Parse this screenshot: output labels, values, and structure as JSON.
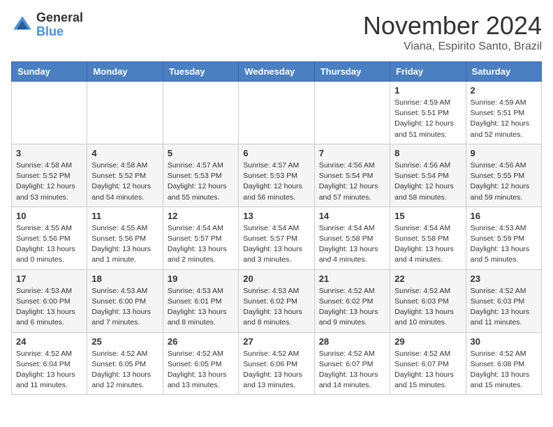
{
  "header": {
    "logo_general": "General",
    "logo_blue": "Blue",
    "month_title": "November 2024",
    "location": "Viana, Espirito Santo, Brazil"
  },
  "calendar": {
    "headers": [
      "Sunday",
      "Monday",
      "Tuesday",
      "Wednesday",
      "Thursday",
      "Friday",
      "Saturday"
    ],
    "rows": [
      [
        {
          "day": "",
          "info": ""
        },
        {
          "day": "",
          "info": ""
        },
        {
          "day": "",
          "info": ""
        },
        {
          "day": "",
          "info": ""
        },
        {
          "day": "",
          "info": ""
        },
        {
          "day": "1",
          "info": "Sunrise: 4:59 AM\nSunset: 5:51 PM\nDaylight: 12 hours\nand 51 minutes."
        },
        {
          "day": "2",
          "info": "Sunrise: 4:59 AM\nSunset: 5:51 PM\nDaylight: 12 hours\nand 52 minutes."
        }
      ],
      [
        {
          "day": "3",
          "info": "Sunrise: 4:58 AM\nSunset: 5:52 PM\nDaylight: 12 hours\nand 53 minutes."
        },
        {
          "day": "4",
          "info": "Sunrise: 4:58 AM\nSunset: 5:52 PM\nDaylight: 12 hours\nand 54 minutes."
        },
        {
          "day": "5",
          "info": "Sunrise: 4:57 AM\nSunset: 5:53 PM\nDaylight: 12 hours\nand 55 minutes."
        },
        {
          "day": "6",
          "info": "Sunrise: 4:57 AM\nSunset: 5:53 PM\nDaylight: 12 hours\nand 56 minutes."
        },
        {
          "day": "7",
          "info": "Sunrise: 4:56 AM\nSunset: 5:54 PM\nDaylight: 12 hours\nand 57 minutes."
        },
        {
          "day": "8",
          "info": "Sunrise: 4:56 AM\nSunset: 5:54 PM\nDaylight: 12 hours\nand 58 minutes."
        },
        {
          "day": "9",
          "info": "Sunrise: 4:56 AM\nSunset: 5:55 PM\nDaylight: 12 hours\nand 59 minutes."
        }
      ],
      [
        {
          "day": "10",
          "info": "Sunrise: 4:55 AM\nSunset: 5:56 PM\nDaylight: 13 hours\nand 0 minutes."
        },
        {
          "day": "11",
          "info": "Sunrise: 4:55 AM\nSunset: 5:56 PM\nDaylight: 13 hours\nand 1 minute."
        },
        {
          "day": "12",
          "info": "Sunrise: 4:54 AM\nSunset: 5:57 PM\nDaylight: 13 hours\nand 2 minutes."
        },
        {
          "day": "13",
          "info": "Sunrise: 4:54 AM\nSunset: 5:57 PM\nDaylight: 13 hours\nand 3 minutes."
        },
        {
          "day": "14",
          "info": "Sunrise: 4:54 AM\nSunset: 5:58 PM\nDaylight: 13 hours\nand 4 minutes."
        },
        {
          "day": "15",
          "info": "Sunrise: 4:54 AM\nSunset: 5:58 PM\nDaylight: 13 hours\nand 4 minutes."
        },
        {
          "day": "16",
          "info": "Sunrise: 4:53 AM\nSunset: 5:59 PM\nDaylight: 13 hours\nand 5 minutes."
        }
      ],
      [
        {
          "day": "17",
          "info": "Sunrise: 4:53 AM\nSunset: 6:00 PM\nDaylight: 13 hours\nand 6 minutes."
        },
        {
          "day": "18",
          "info": "Sunrise: 4:53 AM\nSunset: 6:00 PM\nDaylight: 13 hours\nand 7 minutes."
        },
        {
          "day": "19",
          "info": "Sunrise: 4:53 AM\nSunset: 6:01 PM\nDaylight: 13 hours\nand 8 minutes."
        },
        {
          "day": "20",
          "info": "Sunrise: 4:53 AM\nSunset: 6:02 PM\nDaylight: 13 hours\nand 8 minutes."
        },
        {
          "day": "21",
          "info": "Sunrise: 4:52 AM\nSunset: 6:02 PM\nDaylight: 13 hours\nand 9 minutes."
        },
        {
          "day": "22",
          "info": "Sunrise: 4:52 AM\nSunset: 6:03 PM\nDaylight: 13 hours\nand 10 minutes."
        },
        {
          "day": "23",
          "info": "Sunrise: 4:52 AM\nSunset: 6:03 PM\nDaylight: 13 hours\nand 11 minutes."
        }
      ],
      [
        {
          "day": "24",
          "info": "Sunrise: 4:52 AM\nSunset: 6:04 PM\nDaylight: 13 hours\nand 11 minutes."
        },
        {
          "day": "25",
          "info": "Sunrise: 4:52 AM\nSunset: 6:05 PM\nDaylight: 13 hours\nand 12 minutes."
        },
        {
          "day": "26",
          "info": "Sunrise: 4:52 AM\nSunset: 6:05 PM\nDaylight: 13 hours\nand 13 minutes."
        },
        {
          "day": "27",
          "info": "Sunrise: 4:52 AM\nSunset: 6:06 PM\nDaylight: 13 hours\nand 13 minutes."
        },
        {
          "day": "28",
          "info": "Sunrise: 4:52 AM\nSunset: 6:07 PM\nDaylight: 13 hours\nand 14 minutes."
        },
        {
          "day": "29",
          "info": "Sunrise: 4:52 AM\nSunset: 6:07 PM\nDaylight: 13 hours\nand 15 minutes."
        },
        {
          "day": "30",
          "info": "Sunrise: 4:52 AM\nSunset: 6:08 PM\nDaylight: 13 hours\nand 15 minutes."
        }
      ]
    ]
  }
}
